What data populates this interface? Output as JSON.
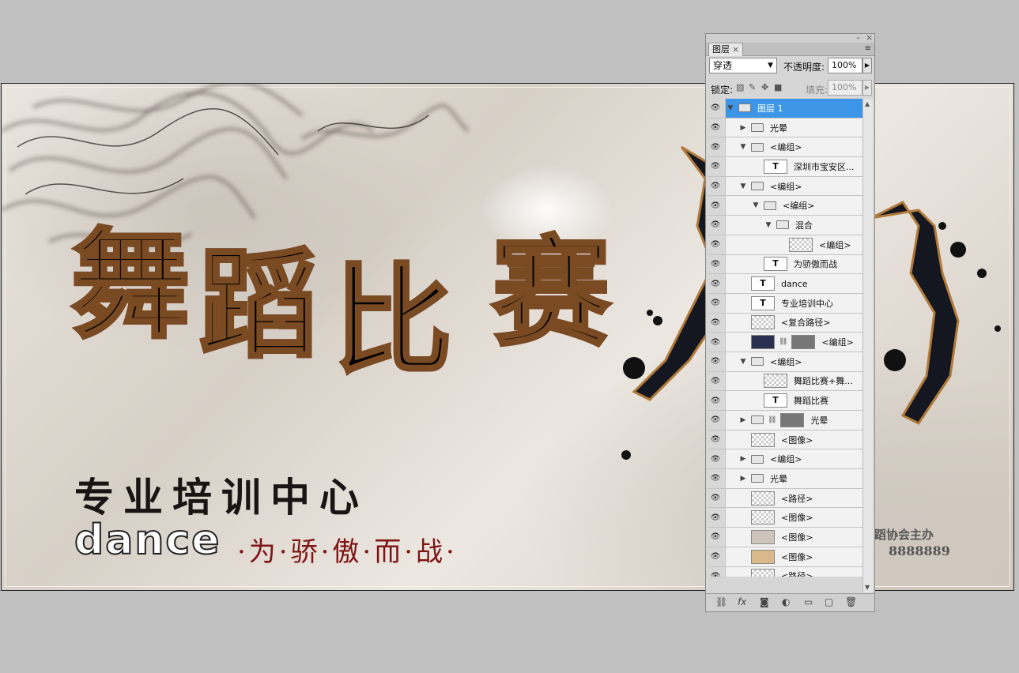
{
  "canvas": {
    "title_chars": [
      "舞",
      "蹈",
      "比",
      "赛"
    ],
    "subtitle": "专业培训中心",
    "dance_word": "dance",
    "slogan": "·为·骄·傲·而·战·",
    "sponsor_fragment": "蹈协会主办",
    "phone_fragment": "8888889"
  },
  "layers_panel": {
    "tab_label": "图层",
    "tab_close": "×",
    "menu_icon": "≡",
    "blend_mode": "穿透",
    "opacity_label": "不透明度:",
    "opacity_value": "100%",
    "lock_label": "锁定:",
    "fill_label": "填充:",
    "fill_value": "100%",
    "layers": [
      {
        "name": "图层 1",
        "indent": 0,
        "kind": "group",
        "expanded": true,
        "selected": true
      },
      {
        "name": "光晕",
        "indent": 1,
        "kind": "group",
        "expanded": false
      },
      {
        "name": "<编组>",
        "indent": 1,
        "kind": "group",
        "expanded": true
      },
      {
        "name": "深圳市宝安区...",
        "indent": 2,
        "kind": "text"
      },
      {
        "name": "<编组>",
        "indent": 1,
        "kind": "group",
        "expanded": true
      },
      {
        "name": "<编组>",
        "indent": 2,
        "kind": "group",
        "expanded": true
      },
      {
        "name": "混合",
        "indent": 3,
        "kind": "group",
        "expanded": true
      },
      {
        "name": "<编组>",
        "indent": 4,
        "kind": "checker"
      },
      {
        "name": "为骄傲而战",
        "indent": 2,
        "kind": "text"
      },
      {
        "name": "dance",
        "indent": 1,
        "kind": "text"
      },
      {
        "name": "专业培训中心",
        "indent": 1,
        "kind": "text"
      },
      {
        "name": "<复合路径>",
        "indent": 1,
        "kind": "checker"
      },
      {
        "name": "<编组>",
        "indent": 1,
        "kind": "masked"
      },
      {
        "name": "<编组>",
        "indent": 1,
        "kind": "group",
        "expanded": true
      },
      {
        "name": "舞蹈比赛+舞...",
        "indent": 2,
        "kind": "checker"
      },
      {
        "name": "舞蹈比赛",
        "indent": 2,
        "kind": "text"
      },
      {
        "name": "光晕",
        "indent": 1,
        "kind": "group-masked",
        "expanded": false
      },
      {
        "name": "<图像>",
        "indent": 1,
        "kind": "checker"
      },
      {
        "name": "<编组>",
        "indent": 1,
        "kind": "group",
        "expanded": false
      },
      {
        "name": "光晕",
        "indent": 1,
        "kind": "group",
        "expanded": false
      },
      {
        "name": "<路径>",
        "indent": 1,
        "kind": "checker"
      },
      {
        "name": "<图像>",
        "indent": 1,
        "kind": "checker"
      },
      {
        "name": "<图像>",
        "indent": 1,
        "kind": "stone"
      },
      {
        "name": "<图像>",
        "indent": 1,
        "kind": "tan"
      },
      {
        "name": "<路径>",
        "indent": 1,
        "kind": "white"
      }
    ],
    "footer_icons": [
      "link-icon",
      "fx-icon",
      "mask-icon",
      "adjustment-icon",
      "new-group-icon",
      "new-layer-icon",
      "trash-icon"
    ]
  }
}
